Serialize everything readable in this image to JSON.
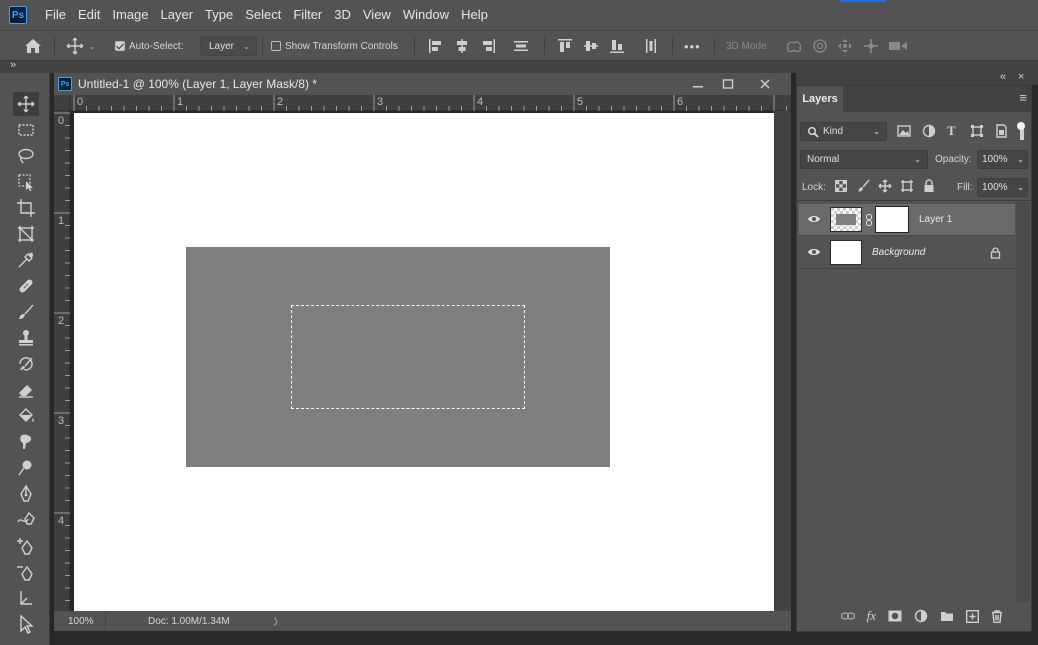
{
  "app": {
    "logo_text": "Ps"
  },
  "menu": [
    "File",
    "Edit",
    "Image",
    "Layer",
    "Type",
    "Select",
    "Filter",
    "3D",
    "View",
    "Window",
    "Help"
  ],
  "options_bar": {
    "auto_select_label": "Auto-Select:",
    "auto_select_checked": true,
    "auto_select_target": "Layer",
    "show_transform_label": "Show Transform Controls",
    "show_transform_checked": false,
    "more_label": "•••",
    "mode_3d_label": "3D Mode:"
  },
  "tools_panel": {
    "collapse_label": "»"
  },
  "document": {
    "logo_text": "Ps",
    "title": "Untitled-1 @ 100% (Layer 1, Layer Mask/8) *",
    "ruler_h": [
      "0",
      "1",
      "2",
      "3",
      "4",
      "5",
      "6"
    ],
    "ruler_v": [
      "0",
      "1",
      "2",
      "3",
      "4"
    ],
    "zoom": "100%",
    "doc_info": "Doc: 1.00M/1.34M",
    "status_arrow": "〉",
    "canvas_color": "#ffffff",
    "layer_fill_color": "#7f7f7f"
  },
  "layers_panel": {
    "tab_label": "Layers",
    "filter_label": "Kind",
    "blend_mode": "Normal",
    "opacity_label": "Opacity:",
    "opacity_value": "100%",
    "lock_label": "Lock:",
    "fill_label": "Fill:",
    "fill_value": "100%",
    "layers": [
      {
        "name": "Layer 1",
        "visible": true,
        "selected": true
      },
      {
        "name": "Background",
        "visible": true,
        "locked": true
      }
    ],
    "collapse_glyph": "«",
    "close_glyph": "×",
    "menu_glyph": "≡"
  }
}
